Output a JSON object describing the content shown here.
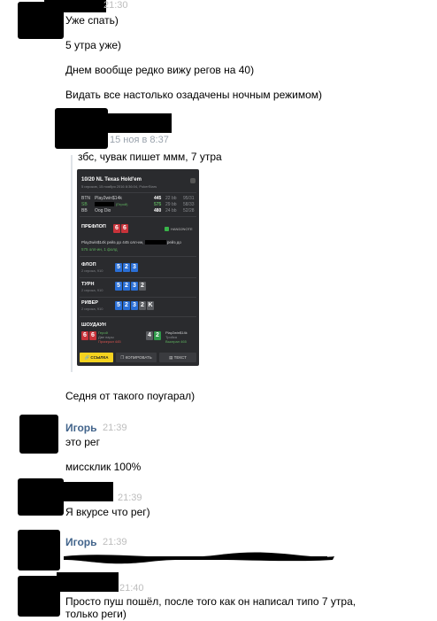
{
  "messages": {
    "m1": "Уже спать)",
    "m2": "5 утра уже)",
    "m3": "Днем вообще редко вижу регов на 40)",
    "m4": "Видать все настолько озадачены ночным режимом)",
    "quote_date": "15 ноя в 8:37",
    "quote_text": "збс, чувак пишет ммм, 7 утра",
    "m5": "Седня от такого поугарал)",
    "m6": "это рег",
    "m7": "миссклик 100%",
    "m8": "Я вкурсе что рег)",
    "m9a": "Просто пуш пошёл, после того как он написал типо 7 утра,",
    "m9b": "только реги)"
  },
  "times": {
    "t1": "21:30",
    "t2": "21:39",
    "t3": "21:39",
    "t4": "21:39",
    "t5": "21:40"
  },
  "author": {
    "igor": "Игорь"
  },
  "card": {
    "title": "10/20 NL Texas Hold'em",
    "subtitle": "5 игроков, 15 ноября 2016 8:36:04, PokerStars",
    "players": [
      {
        "pos": "BTN",
        "name": "Play2win$14k",
        "tag": "",
        "chips": "445",
        "bb": "22 bb",
        "stat": "95/31"
      },
      {
        "pos": "SB",
        "name": "",
        "tag": "(Герой)",
        "chips": "575",
        "bb": "29 bb",
        "stat": "58/33"
      },
      {
        "pos": "BB",
        "name": "Oog Dio",
        "tag": "",
        "chips": "480",
        "bb": "24 bb",
        "stat": "52/28"
      }
    ],
    "preflop": "ПРЕФЛОП",
    "brand": "HAND2NOTE",
    "preflop_text": "Play2win$14k рейз до 445 олл-ин,",
    "preflop_text2": "рейз до",
    "preflop_text3": "575 олл-ин, 1 фолд",
    "flop": "ФЛОП",
    "flop_sub": "2 игрока, 910",
    "turn": "ТУРН",
    "turn_sub": "2 игрока, 910",
    "river": "РИВЕР",
    "river_sub": "2 игрока, 910",
    "showdown": "ШОУДАУН",
    "sd_left_name": "Герой",
    "sd_left_sub": "Две пары",
    "sd_left_res": "Проиграл 445",
    "sd_right_name": "Play2win$14k",
    "sd_right_sub": "Тройка",
    "sd_right_res": "Выиграл 465",
    "btn_link": "ССЫЛКА",
    "btn_copy": "КОПИРОВАТЬ",
    "btn_text": "ТЕКСТ",
    "cards": {
      "pre": [
        "6",
        "6"
      ],
      "flop": [
        "5",
        "2",
        "3"
      ],
      "turn": [
        "5",
        "2",
        "3",
        "2"
      ],
      "river": [
        "5",
        "2",
        "3",
        "2",
        "K"
      ],
      "sd_left": [
        "6",
        "6"
      ],
      "sd_right": [
        "4",
        "2"
      ]
    }
  }
}
